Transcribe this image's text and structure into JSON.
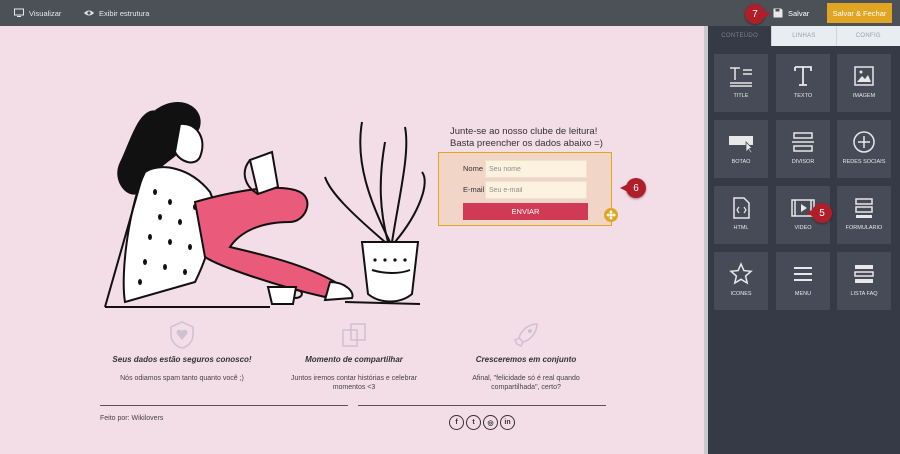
{
  "toolbar": {
    "preview_label": "Visualizar",
    "structure_label": "Exibir estrutura",
    "save_label": "Salvar",
    "save_close_label": "Salvar & Fechar"
  },
  "markers": {
    "m5": "5",
    "m6": "6",
    "m7": "7"
  },
  "canvas": {
    "headline_line1": "Junte-se ao nosso clube de leitura!",
    "headline_line2": "Basta preencher os dados abaixo =)",
    "form": {
      "name_label": "Nome",
      "name_placeholder": "Seu nome",
      "email_label": "E-mail",
      "email_placeholder": "Seu e-mail",
      "submit_label": "ENVIAR"
    },
    "features": [
      {
        "icon": "shield-heart-icon",
        "title": "Seus dados estão seguros conosco!",
        "desc": "Nós odiamos spam tanto quanto você ;)"
      },
      {
        "icon": "share-icon",
        "title": "Momento de compartilhar",
        "desc": "Juntos iremos contar histórias e celebrar momentos <3"
      },
      {
        "icon": "rocket-icon",
        "title": "Cresceremos em conjunto",
        "desc": "Afinal, \"felicidade só é real quando compartilhada\", certo?"
      }
    ],
    "footer_text": "Feito por: Wikilovers",
    "socials": [
      {
        "icon": "facebook-icon",
        "glyph": "f"
      },
      {
        "icon": "twitter-icon",
        "glyph": "t"
      },
      {
        "icon": "instagram-icon",
        "glyph": "◎"
      },
      {
        "icon": "linkedin-icon",
        "glyph": "in"
      }
    ]
  },
  "panel": {
    "tabs": [
      "CONTEÚDO",
      "LINHAS",
      "CONFIG"
    ],
    "widgets": [
      {
        "label": "TITLE",
        "icon": "title-icon"
      },
      {
        "label": "TEXTO",
        "icon": "text-icon"
      },
      {
        "label": "IMAGEM",
        "icon": "image-icon"
      },
      {
        "label": "BOTAO",
        "icon": "button-icon"
      },
      {
        "label": "DIVISOR",
        "icon": "divider-icon"
      },
      {
        "label": "REDES SOCIAIS",
        "icon": "social-icon"
      },
      {
        "label": "HTML",
        "icon": "html-icon"
      },
      {
        "label": "VIDEO",
        "icon": "video-icon"
      },
      {
        "label": "FORMULARIO",
        "icon": "form-icon"
      },
      {
        "label": "ICONES",
        "icon": "star-icon"
      },
      {
        "label": "MENU",
        "icon": "menu-icon"
      },
      {
        "label": "LISTA FAQ",
        "icon": "faq-icon"
      }
    ]
  },
  "colors": {
    "toolbar_bg": "#4b5157",
    "canvas_bg": "#f3dde6",
    "panel_bg": "#363a47",
    "accent_gold": "#e0a623",
    "send_button": "#d13a53",
    "marker_red": "#b01e2a"
  }
}
